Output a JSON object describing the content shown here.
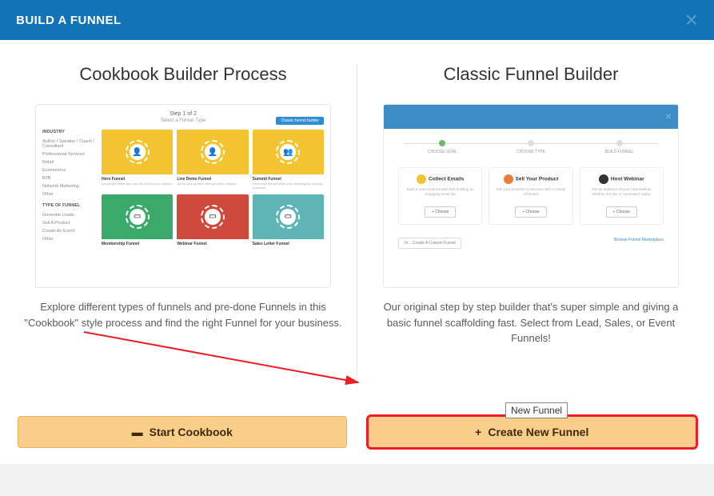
{
  "header": {
    "title": "BUILD A FUNNEL"
  },
  "cookbook": {
    "title": "Cookbook Builder Process",
    "preview": {
      "step_label": "Step 1 of 2",
      "step_sub": "Select a Funnel Type",
      "badge": "Classic funnel builder",
      "side_head1": "INDUSTRY",
      "side_items1": [
        "Author / Speaker / Coach / Consultant",
        "Professional Services",
        "Retail",
        "Ecommerce",
        "B2B",
        "Network Marketing",
        "Other"
      ],
      "side_head2": "TYPE OF FUNNEL",
      "side_items2": [
        "Generate Leads",
        "Sell A Product",
        "Create An Event",
        "Other"
      ],
      "cards": [
        {
          "color": "yellow",
          "label": "Hero Funnel",
          "desc": "Let people know who you are and how to connect"
        },
        {
          "color": "yellow",
          "label": "Live Demo Funnel",
          "desc": "Demo your product through a live webinar"
        },
        {
          "color": "yellow",
          "label": "Summit Funnel",
          "desc": "Grow your list and build your following by running a summit"
        },
        {
          "color": "green",
          "label": "Membership Funnel",
          "desc": ""
        },
        {
          "color": "red",
          "label": "Webinar Funnel",
          "desc": ""
        },
        {
          "color": "teal",
          "label": "Sales Letter Funnel",
          "desc": ""
        }
      ]
    },
    "description": "Explore different types of funnels and pre-done Funnels in this \"Cookbook\" style process and find the right Funnel for your business.",
    "button": "Start Cookbook"
  },
  "classic": {
    "title": "Classic Funnel Builder",
    "preview": {
      "steps": [
        "CHOOSE GOAL",
        "CHOOSE TYPE",
        "BUILD FUNNEL"
      ],
      "cards": [
        {
          "icon": "#f4c430",
          "title": "Collect Emails",
          "desc": "Build a new email list and start building an engaging email list",
          "choose": "+ Choose"
        },
        {
          "icon": "#e97b3c",
          "title": "Sell Your Product",
          "desc": "Sell your products or services with a variety of funnels",
          "choose": "+ Choose"
        },
        {
          "icon": "#333",
          "title": "Host Webinar",
          "desc": "Get an audience at your next webinar whether it is live or automated replay",
          "choose": "+ Choose"
        }
      ],
      "custom_btn": "Or... Create A Custom Funnel",
      "browse": "Browse Funnel Marketplace"
    },
    "description": "Our original step by step builder that's super simple and giving a basic funnel scaffolding fast. Select from Lead, Sales, or Event Funnels!",
    "button": "Create New Funnel"
  },
  "tooltip": "New Funnel"
}
